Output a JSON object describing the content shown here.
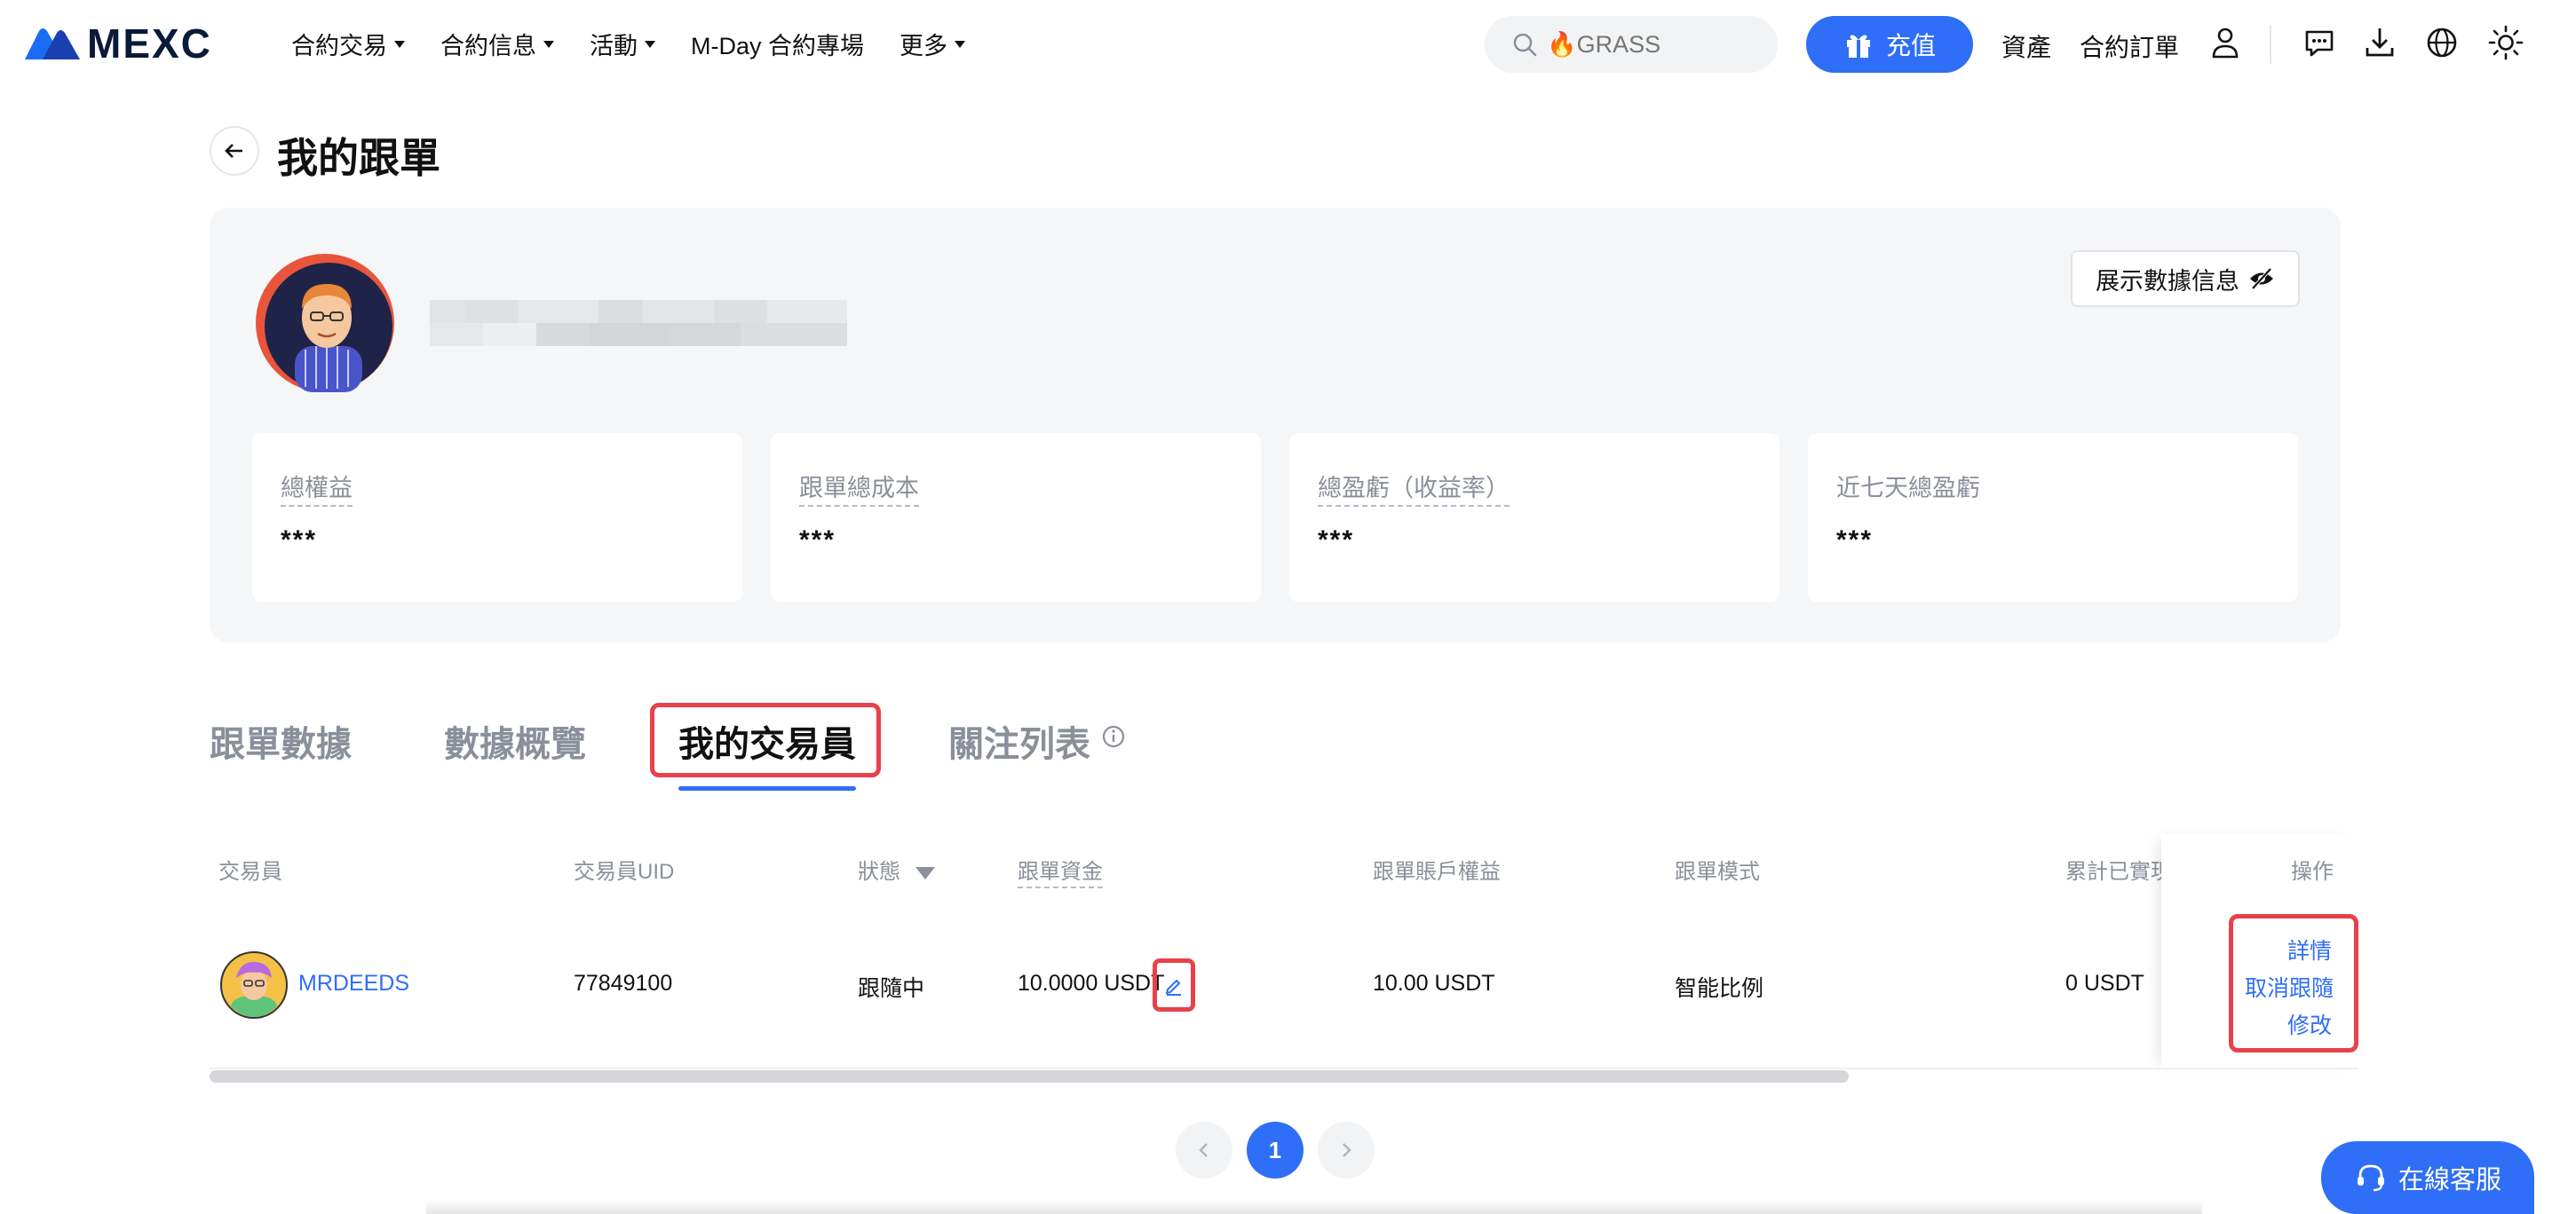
{
  "header": {
    "logo_text": "MEXC",
    "nav": [
      {
        "label": "合約交易",
        "has_caret": true
      },
      {
        "label": "合約信息",
        "has_caret": true
      },
      {
        "label": "活動",
        "has_caret": true
      },
      {
        "label": "M-Day 合約專場",
        "has_caret": false
      },
      {
        "label": "更多",
        "has_caret": true
      }
    ],
    "search_placeholder": "🔥GRASS",
    "deposit_label": "充值",
    "assets_label": "資產",
    "orders_label": "合約訂單",
    "colors": {
      "accent": "#2f6ef6",
      "highlight": "#e8414a",
      "muted": "#8a8f99"
    }
  },
  "page": {
    "title": "我的跟單"
  },
  "profile": {
    "show_data_label": "展示數據信息",
    "stats": [
      {
        "label": "總權益",
        "value": "***",
        "dashed": true
      },
      {
        "label": "跟單總成本",
        "value": "***",
        "dashed": true
      },
      {
        "label": "總盈虧（收益率）",
        "value": "***",
        "dashed": true
      },
      {
        "label": "近七天總盈虧",
        "value": "***",
        "dashed": false
      }
    ]
  },
  "tabs": [
    {
      "label": "跟單數據",
      "active": false
    },
    {
      "label": "數據概覽",
      "active": false
    },
    {
      "label": "我的交易員",
      "active": true
    },
    {
      "label": "關注列表",
      "active": false
    }
  ],
  "table": {
    "headers": {
      "trader": "交易員",
      "uid": "交易員UID",
      "status": "狀態",
      "funds": "跟單資金",
      "equity": "跟單賬戶權益",
      "mode": "跟單模式",
      "realized": "累計已實現",
      "action": "操作"
    },
    "rows": [
      {
        "trader": "MRDEEDS",
        "uid": "77849100",
        "status": "跟隨中",
        "funds": "10.0000 USDT",
        "equity": "10.00 USDT",
        "mode": "智能比例",
        "realized": "0 USDT",
        "actions": [
          "詳情",
          "取消跟隨",
          "修改"
        ]
      }
    ]
  },
  "pagination": {
    "current": "1"
  },
  "support_label": "在線客服"
}
